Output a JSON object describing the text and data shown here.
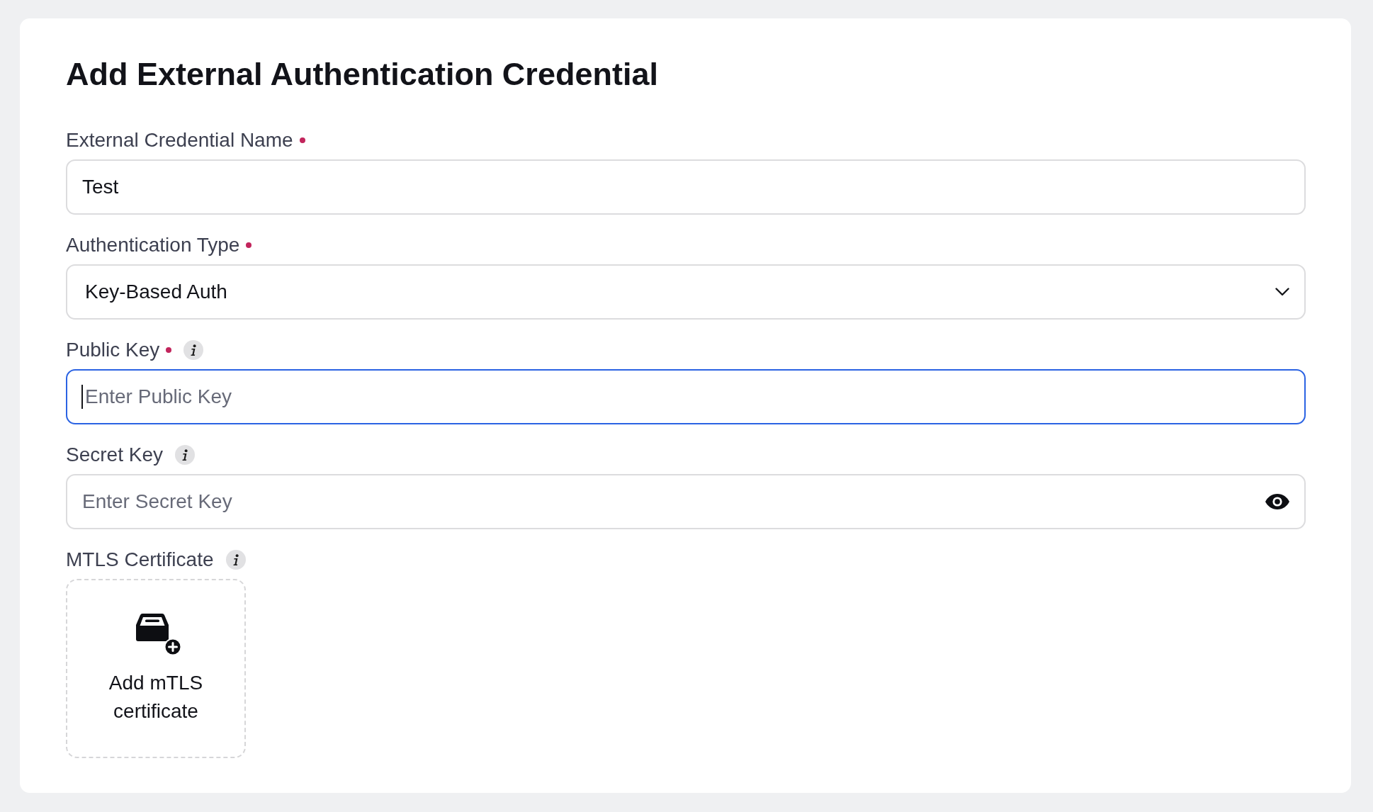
{
  "title": "Add External Authentication Credential",
  "fields": [
    {
      "kind": "text",
      "label": "External Credential Name",
      "required": true,
      "info": false,
      "focused": false,
      "value": "Test"
    },
    {
      "kind": "select",
      "label": "Authentication Type",
      "required": true,
      "info": false,
      "focused": false,
      "value": "Key-Based Auth"
    },
    {
      "kind": "text",
      "label": "Public Key",
      "required": true,
      "info": true,
      "focused": true,
      "placeholder": "Enter Public Key"
    },
    {
      "kind": "password",
      "label": "Secret Key",
      "required": false,
      "info": true,
      "focused": false,
      "placeholder": "Enter Secret Key"
    },
    {
      "kind": "upload",
      "label": "MTLS Certificate",
      "required": false,
      "info": true,
      "focused": false,
      "button": "Add mTLS certificate"
    }
  ]
}
